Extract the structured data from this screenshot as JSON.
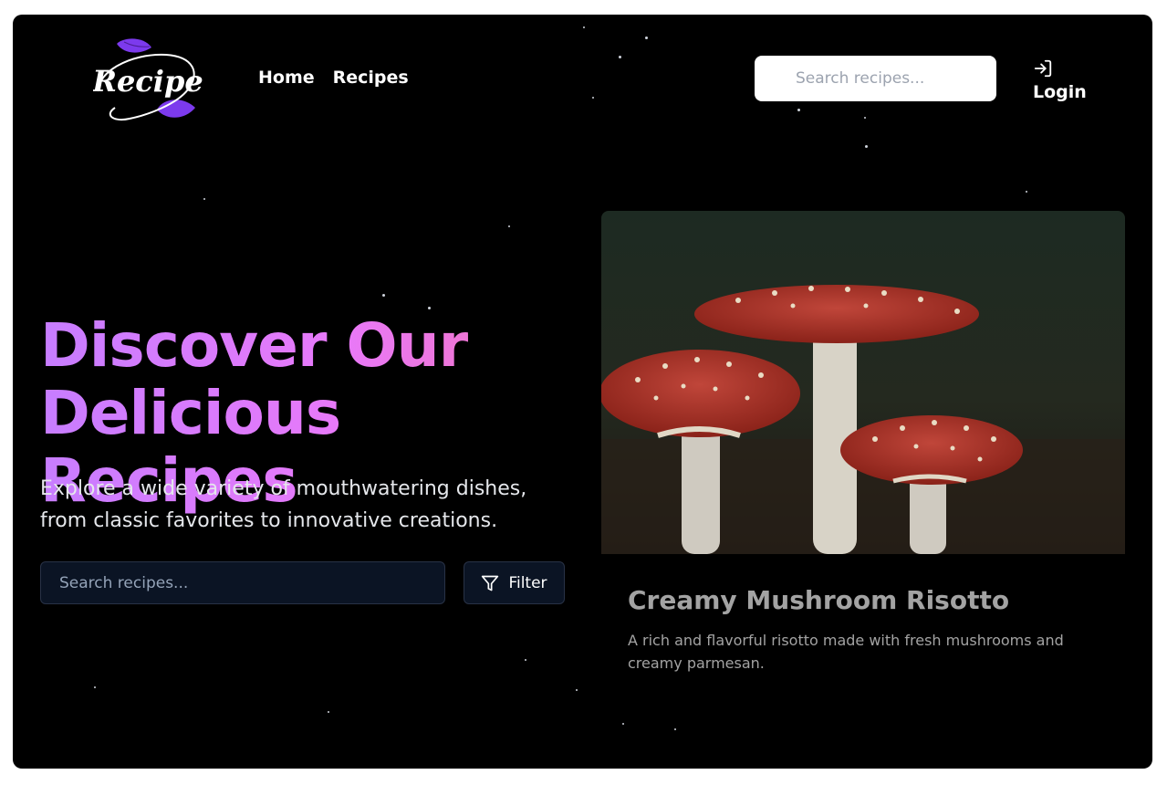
{
  "brand": {
    "logo_text": "Recipe"
  },
  "nav": {
    "items": [
      "Home",
      "Recipes"
    ]
  },
  "header": {
    "search_placeholder": "Search recipes...",
    "login_label": "Login"
  },
  "hero": {
    "title_line1": "Discover Our",
    "title_line2": "Delicious Recipes",
    "subtitle_line1": "Explore a wide variety of mouthwatering dishes,",
    "subtitle_line2": "from classic favorites to innovative creations.",
    "search_placeholder": "Search recipes...",
    "filter_label": "Filter"
  },
  "featured": {
    "title": "Creamy Mushroom Risotto",
    "description": "A rich and flavorful risotto made with fresh mushrooms and creamy parmesan."
  },
  "colors": {
    "background": "#000000",
    "gradient_start": "#c77dff",
    "gradient_end": "#f472b6",
    "logo_leaf": "#7c3aed",
    "input_bg": "#0b1424"
  }
}
